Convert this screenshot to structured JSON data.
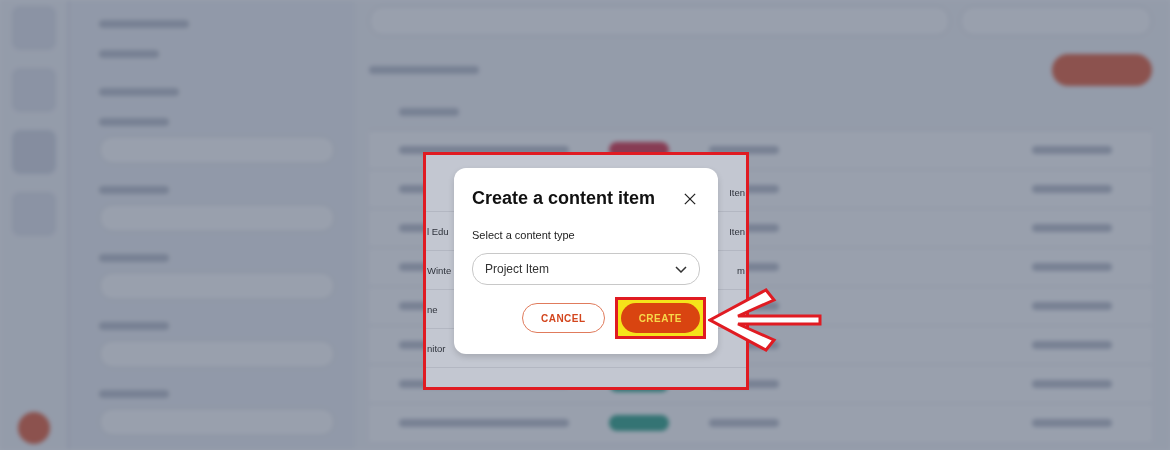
{
  "dialog": {
    "title": "Create a content item",
    "field_label": "Select a content type",
    "select_value": "Project Item",
    "buttons": [
      {
        "label": "CANCEL",
        "kind": "secondary",
        "highlighted": false
      },
      {
        "label": "CREATE",
        "kind": "primary",
        "highlighted": true
      }
    ]
  },
  "background_fragments": [
    {
      "right": "Iten"
    },
    {
      "left": "l Edu",
      "right": "Iten"
    },
    {
      "left": "Winte",
      "right": "m"
    },
    {
      "left": "ne"
    },
    {
      "left": "nitor"
    }
  ]
}
